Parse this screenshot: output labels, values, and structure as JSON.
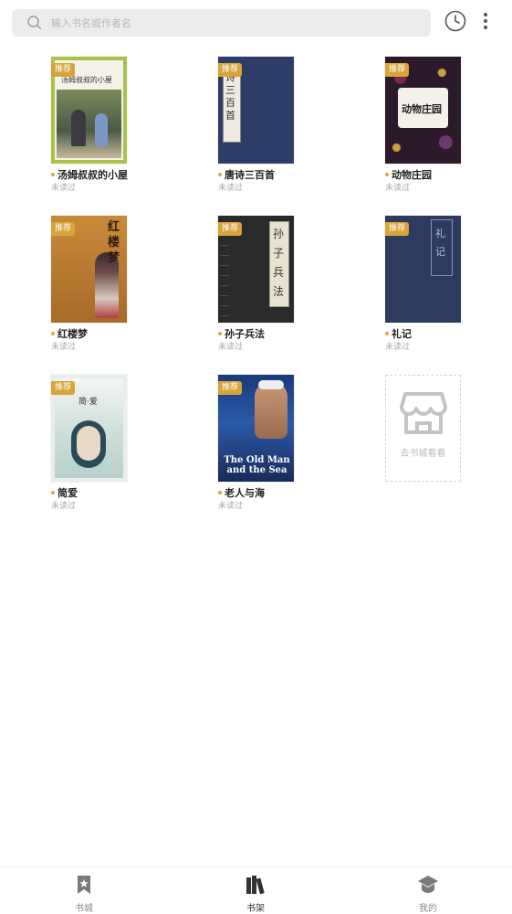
{
  "search": {
    "placeholder": "输入书名或作者名"
  },
  "toolbar": {
    "history_icon": "clock-icon",
    "more_icon": "more-vert-icon"
  },
  "colors": {
    "tag": "#d8a43a",
    "dot": "#e8a23b",
    "active_nav": "#333333",
    "inactive_nav": "#8a8a8a"
  },
  "books": [
    {
      "title": "汤姆叔叔的小屋",
      "status": "未读过",
      "tag": "推荐",
      "cover_text": "汤姆叔叔的小屋"
    },
    {
      "title": "唐诗三百首",
      "status": "未读过",
      "tag": "推荐",
      "cover_text": "诗三百首"
    },
    {
      "title": "动物庄园",
      "status": "未读过",
      "tag": "推荐",
      "cover_text": "动物庄园"
    },
    {
      "title": "红楼梦",
      "status": "未读过",
      "tag": "推荐",
      "cover_text": "红楼梦"
    },
    {
      "title": "孙子兵法",
      "status": "未读过",
      "tag": "推荐",
      "cover_text": "孙子兵法"
    },
    {
      "title": "礼记",
      "status": "未读过",
      "tag": "推荐",
      "cover_text": "礼记"
    },
    {
      "title": "简爱",
      "status": "未读过",
      "tag": "推荐",
      "cover_text": "简·爱"
    },
    {
      "title": "老人与海",
      "status": "未读过",
      "tag": "推荐",
      "cover_text": "The Old Man and the Sea"
    }
  ],
  "add_book": {
    "label": "去书城看看",
    "icon": "store-icon"
  },
  "nav": [
    {
      "label": "书城",
      "icon": "bookmark-icon",
      "active": false
    },
    {
      "label": "书架",
      "icon": "bookshelf-icon",
      "active": true
    },
    {
      "label": "我的",
      "icon": "graduation-cap-icon",
      "active": false
    }
  ]
}
